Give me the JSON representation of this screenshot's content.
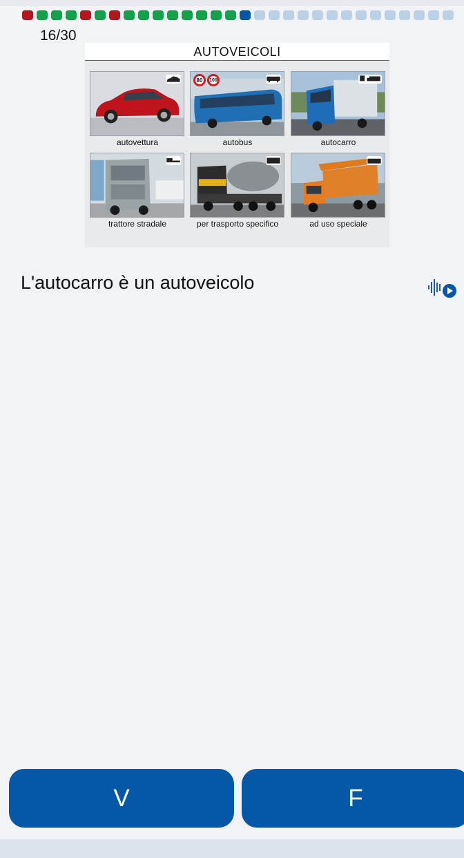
{
  "progress": {
    "counter": "16/30",
    "dots": [
      "red",
      "green",
      "green",
      "green",
      "red",
      "green",
      "red",
      "green",
      "green",
      "green",
      "green",
      "green",
      "green",
      "green",
      "green",
      "blue",
      "pending",
      "pending",
      "pending",
      "pending",
      "pending",
      "pending",
      "pending",
      "pending",
      "pending",
      "pending",
      "pending",
      "pending",
      "pending",
      "pending"
    ]
  },
  "figure": {
    "title": "AUTOVEICOLI",
    "tiles": [
      {
        "caption": "autovettura",
        "icon": "car-photo"
      },
      {
        "caption": "autobus",
        "icon": "bus-photo",
        "badges": [
          "80",
          "100"
        ]
      },
      {
        "caption": "autocarro",
        "icon": "truck-photo"
      },
      {
        "caption": "trattore stradale",
        "icon": "tractor-unit-photo"
      },
      {
        "caption": "per trasporto specifico",
        "icon": "concrete-mixer-photo"
      },
      {
        "caption": "ad uso speciale",
        "icon": "special-vehicle-photo"
      }
    ]
  },
  "question": {
    "text": "L'autocarro è un autoveicolo",
    "audio_icon": "audio-play-icon"
  },
  "answers": {
    "true_label": "V",
    "false_label": "F"
  },
  "colors": {
    "accent": "#0458a6",
    "correct": "#13a24a",
    "wrong": "#b3161f",
    "current": "#0057a8",
    "pending": "#bcd0e6"
  }
}
